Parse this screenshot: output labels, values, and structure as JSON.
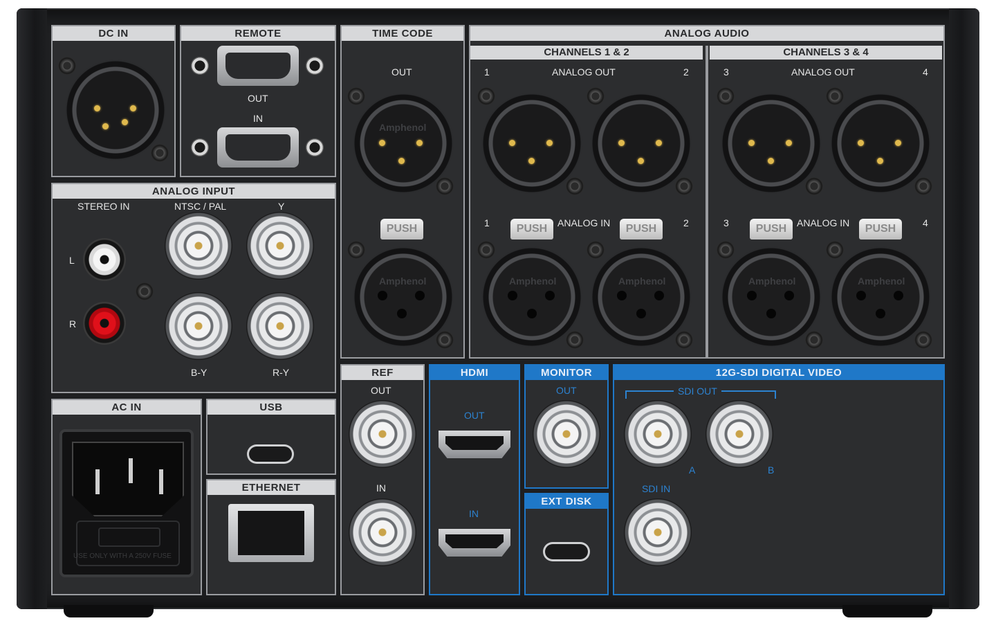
{
  "sections": {
    "dc_in": "DC IN",
    "remote": "REMOTE",
    "time_code": "TIME CODE",
    "analog_audio": "ANALOG AUDIO",
    "channels_12": "CHANNELS 1 & 2",
    "channels_34": "CHANNELS 3 & 4",
    "analog_input": "ANALOG INPUT",
    "ref": "REF",
    "hdmi": "HDMI",
    "monitor": "MONITOR",
    "sdi": "12G-SDI DIGITAL VIDEO",
    "ac_in": "AC IN",
    "usb": "USB",
    "ethernet": "ETHERNET",
    "ext_disk": "EXT DISK"
  },
  "labels": {
    "out": "OUT",
    "in": "IN",
    "analog_out": "ANALOG OUT",
    "analog_in": "ANALOG IN",
    "stereo_in": "STEREO IN",
    "ntsc_pal": "NTSC / PAL",
    "y": "Y",
    "l": "L",
    "r": "R",
    "b_y": "B-Y",
    "r_y": "R-Y",
    "sdi_out": "SDI OUT",
    "sdi_in": "SDI IN",
    "a": "A",
    "b": "B",
    "push": "PUSH",
    "amphenol": "Amphenol",
    "ch1": "1",
    "ch2": "2",
    "ch3": "3",
    "ch4": "4",
    "fuse": "USE ONLY WITH A 250V FUSE"
  },
  "colors": {
    "accent_blue": "#1f78c8",
    "panel": "#2c2d2f",
    "header": "#d7d8da"
  }
}
